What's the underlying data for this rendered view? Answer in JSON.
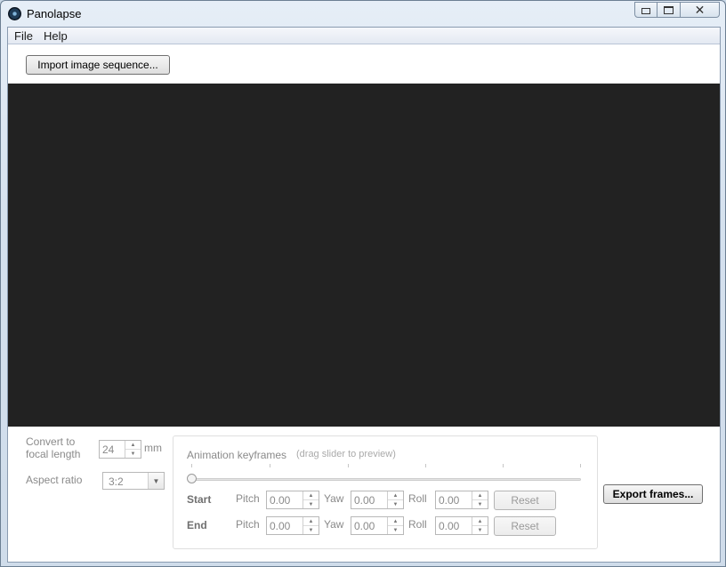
{
  "window": {
    "title": "Panolapse",
    "icon": "panolapse-lens-icon",
    "controls": {
      "minimize": "minimize-icon",
      "maximize": "maximize-icon",
      "close": "✕"
    }
  },
  "menu": {
    "items": [
      "File",
      "Help"
    ]
  },
  "toolbar": {
    "import_label": "Import image sequence..."
  },
  "settings": {
    "focal_label_line1": "Convert to",
    "focal_label_line2": "focal length",
    "focal_value": "24",
    "focal_unit": "mm",
    "aspect_label": "Aspect ratio",
    "aspect_value": "3:2"
  },
  "keyframes": {
    "title": "Animation keyframes",
    "hint": "(drag slider to preview)",
    "slider_position": 0,
    "start": {
      "label": "Start",
      "pitch_label": "Pitch",
      "pitch": "0.00",
      "yaw_label": "Yaw",
      "yaw": "0.00",
      "roll_label": "Roll",
      "roll": "0.00",
      "reset_label": "Reset"
    },
    "end": {
      "label": "End",
      "pitch_label": "Pitch",
      "pitch": "0.00",
      "yaw_label": "Yaw",
      "yaw": "0.00",
      "roll_label": "Roll",
      "roll": "0.00",
      "reset_label": "Reset"
    }
  },
  "export": {
    "label": "Export frames..."
  },
  "colors": {
    "viewport": "#222222",
    "disabled_text": "#8a8a8a"
  }
}
